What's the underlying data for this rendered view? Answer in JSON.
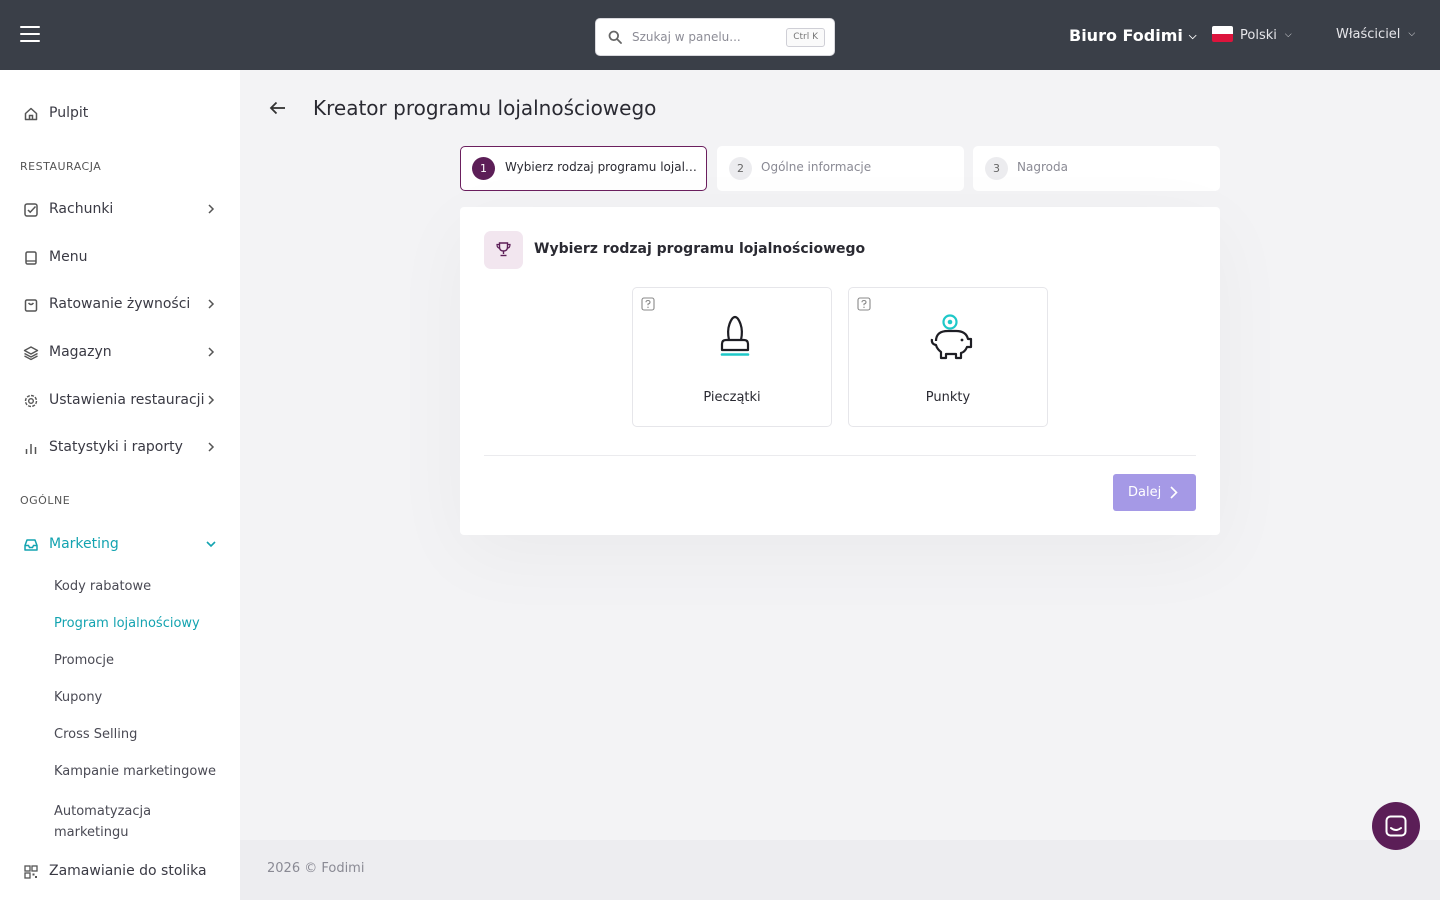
{
  "header": {
    "search_placeholder": "Szukaj w panelu...",
    "search_shortcut": "Ctrl K",
    "organization": "Biuro Fodimi",
    "language": "Polski",
    "user_role": "Właściciel"
  },
  "sidebar": {
    "dashboard": "Pulpit",
    "section_restaurant": "RESTAURACJA",
    "bills": "Rachunki",
    "menu": "Menu",
    "food_rescue": "Ratowanie żywności",
    "warehouse": "Magazyn",
    "restaurant_settings": "Ustawienia restauracji",
    "stats_reports": "Statystyki i raporty",
    "section_general": "OGÓLNE",
    "marketing": "Marketing",
    "marketing_items": [
      "Kody rabatowe",
      "Program lojalnościowy",
      "Promocje",
      "Kupony",
      "Cross Selling",
      "Kampanie marketingowe",
      "Automatyzacja marketingu"
    ],
    "table_ordering": "Zamawianie do stolika"
  },
  "page": {
    "title": "Kreator programu lojalnościowego"
  },
  "steps": [
    {
      "number": "1",
      "label": "Wybierz rodzaj programu lojalnościowego"
    },
    {
      "number": "2",
      "label": "Ogólne informacje"
    },
    {
      "number": "3",
      "label": "Nagroda"
    }
  ],
  "card": {
    "title": "Wybierz rodzaj programu lojalnościowego",
    "options": [
      {
        "label": "Pieczątki",
        "icon": "stamp-icon"
      },
      {
        "label": "Punkty",
        "icon": "piggy-bank-icon"
      }
    ],
    "next_label": "Dalej"
  },
  "footer": {
    "text": "2026 © Fodimi"
  },
  "colors": {
    "topbar": "#3a3f48",
    "accent_teal": "#13a3b0",
    "accent_plum": "#5c1e57",
    "button_purple": "#a599e6"
  }
}
